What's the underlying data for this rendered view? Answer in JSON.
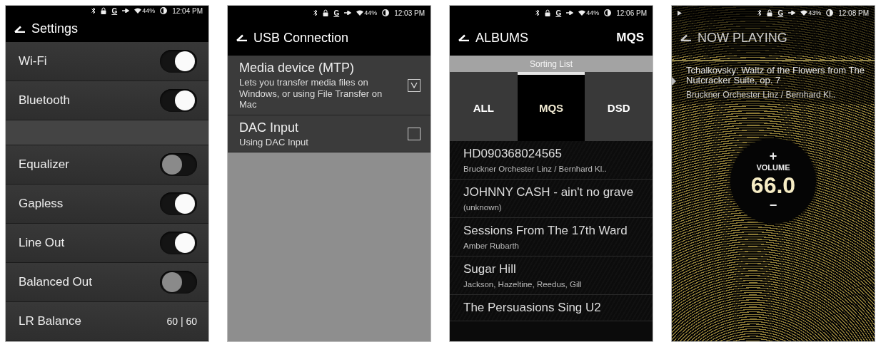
{
  "screens": [
    {
      "kind": "settings",
      "status": {
        "playing": false,
        "mode": "G",
        "battery": "44%",
        "time": "12:04 PM"
      },
      "header": {
        "title": "Settings"
      },
      "sections": [
        {
          "rows": [
            {
              "kind": "toggle",
              "label": "Wi-Fi",
              "on": true
            },
            {
              "kind": "toggle",
              "label": "Bluetooth",
              "on": true
            }
          ]
        },
        {
          "rows": [
            {
              "kind": "toggle",
              "label": "Equalizer",
              "on": false
            },
            {
              "kind": "toggle",
              "label": "Gapless",
              "on": true
            },
            {
              "kind": "toggle",
              "label": "Line Out",
              "on": true
            },
            {
              "kind": "toggle",
              "label": "Balanced Out",
              "on": false
            },
            {
              "kind": "value",
              "label": "LR Balance",
              "value": "60 | 60"
            }
          ]
        }
      ]
    },
    {
      "kind": "usb",
      "status": {
        "playing": false,
        "mode": "G",
        "battery": "44%",
        "time": "12:03 PM"
      },
      "header": {
        "title": "USB Connection"
      },
      "options": [
        {
          "title": "Media device (MTP)",
          "description": "Lets you transfer media files on Windows, or using File Transfer on Mac",
          "checked": true
        },
        {
          "title": "DAC Input",
          "description": "Using DAC Input",
          "checked": false
        }
      ]
    },
    {
      "kind": "albums",
      "status": {
        "playing": false,
        "mode": "G",
        "battery": "44%",
        "time": "12:06 PM"
      },
      "header": {
        "title": "ALBUMS",
        "action": "MQS"
      },
      "sort_label": "Sorting List",
      "tabs": [
        {
          "label": "ALL",
          "selected": false
        },
        {
          "label": "MQS",
          "selected": true
        },
        {
          "label": "DSD",
          "selected": false
        }
      ],
      "albums": [
        {
          "title": "HD090368024565",
          "artist": "Bruckner Orchester Linz / Bernhard Kl.."
        },
        {
          "title": "JOHNNY CASH - ain't no grave",
          "artist": "(unknown)"
        },
        {
          "title": "Sessions From The 17th Ward",
          "artist": "Amber Rubarth"
        },
        {
          "title": "Sugar Hill",
          "artist": "Jackson, Hazeltine, Reedus, Gill"
        },
        {
          "title": "The Persuasions Sing U2"
        }
      ]
    },
    {
      "kind": "now_playing",
      "status": {
        "playing": true,
        "mode": "G",
        "battery": "43%",
        "time": "12:08 PM"
      },
      "header": {
        "title": "NOW PLAYING"
      },
      "track": {
        "title": "Tchalkovsky: Waltz of the Flowers from The Nutcracker Suite, op. 7",
        "artist": "Bruckner Orchester Linz / Bernhard Kl.."
      },
      "volume": {
        "up": "+",
        "label": "VOLUME",
        "value": "66.0",
        "down": "−"
      }
    }
  ]
}
